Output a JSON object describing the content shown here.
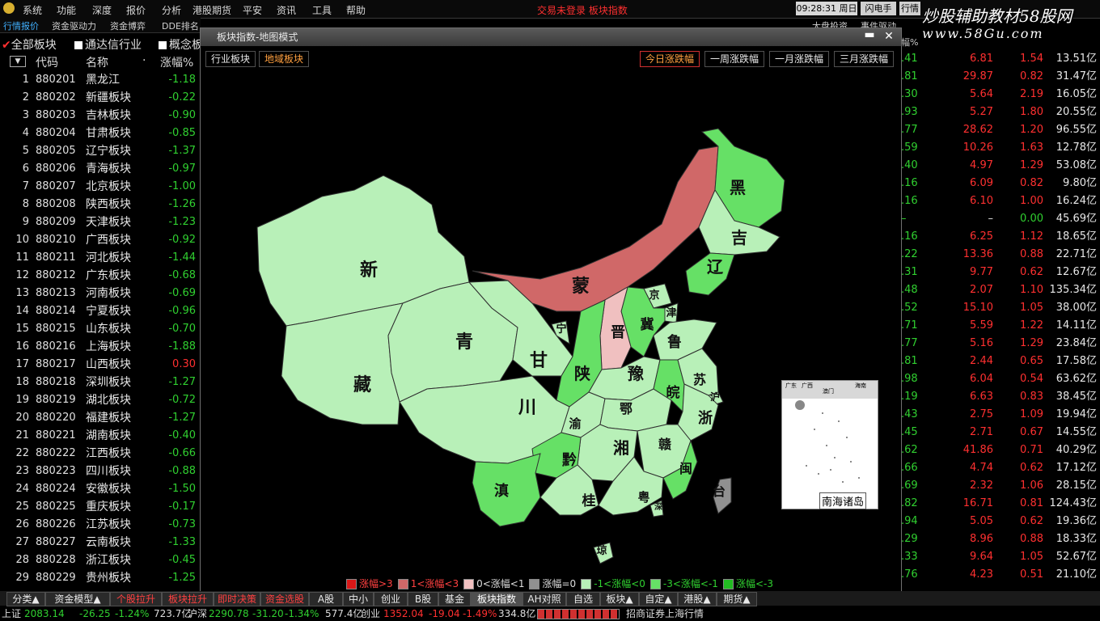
{
  "menu": [
    "系统",
    "功能",
    "深度",
    "报价",
    "分析",
    "港股期货",
    "平安",
    "资讯",
    "工具",
    "帮助"
  ],
  "menu_status": "交易未登录   板块指数",
  "clock": "09:28:31 周日",
  "top_buttons": [
    "闪电手",
    "行情"
  ],
  "watermark": {
    "line1": "炒股辅助教材58股网",
    "line2": "www.58Gu.com"
  },
  "tabs": [
    "行情报价",
    "资金驱动力",
    "资金博弈",
    "DDE排名"
  ],
  "right_top_tabs": [
    "大盘投资",
    "事件驱动"
  ],
  "filters": [
    "全部板块",
    "通达信行业",
    "概念板"
  ],
  "list_header": {
    "code": "代码",
    "name": "名称",
    "dot": "·",
    "pct": "涨幅%"
  },
  "rows": [
    {
      "no": "1",
      "code": "880201",
      "name": "黑龙江",
      "pct": "-1.18"
    },
    {
      "no": "2",
      "code": "880202",
      "name": "新疆板块",
      "pct": "-0.22"
    },
    {
      "no": "3",
      "code": "880203",
      "name": "吉林板块",
      "pct": "-0.90"
    },
    {
      "no": "4",
      "code": "880204",
      "name": "甘肃板块",
      "pct": "-0.85"
    },
    {
      "no": "5",
      "code": "880205",
      "name": "辽宁板块",
      "pct": "-1.37"
    },
    {
      "no": "6",
      "code": "880206",
      "name": "青海板块",
      "pct": "-0.97"
    },
    {
      "no": "7",
      "code": "880207",
      "name": "北京板块",
      "pct": "-1.00"
    },
    {
      "no": "8",
      "code": "880208",
      "name": "陕西板块",
      "pct": "-1.26"
    },
    {
      "no": "9",
      "code": "880209",
      "name": "天津板块",
      "pct": "-1.23"
    },
    {
      "no": "10",
      "code": "880210",
      "name": "广西板块",
      "pct": "-0.92"
    },
    {
      "no": "11",
      "code": "880211",
      "name": "河北板块",
      "pct": "-1.44"
    },
    {
      "no": "12",
      "code": "880212",
      "name": "广东板块",
      "pct": "-0.68"
    },
    {
      "no": "13",
      "code": "880213",
      "name": "河南板块",
      "pct": "-0.69"
    },
    {
      "no": "14",
      "code": "880214",
      "name": "宁夏板块",
      "pct": "-0.96"
    },
    {
      "no": "15",
      "code": "880215",
      "name": "山东板块",
      "pct": "-0.70"
    },
    {
      "no": "16",
      "code": "880216",
      "name": "上海板块",
      "pct": "-1.88"
    },
    {
      "no": "17",
      "code": "880217",
      "name": "山西板块",
      "pct": "0.30"
    },
    {
      "no": "18",
      "code": "880218",
      "name": "深圳板块",
      "pct": "-1.27"
    },
    {
      "no": "19",
      "code": "880219",
      "name": "湖北板块",
      "pct": "-0.72"
    },
    {
      "no": "20",
      "code": "880220",
      "name": "福建板块",
      "pct": "-1.27"
    },
    {
      "no": "21",
      "code": "880221",
      "name": "湖南板块",
      "pct": "-0.40"
    },
    {
      "no": "22",
      "code": "880222",
      "name": "江西板块",
      "pct": "-0.66"
    },
    {
      "no": "23",
      "code": "880223",
      "name": "四川板块",
      "pct": "-0.88"
    },
    {
      "no": "24",
      "code": "880224",
      "name": "安徽板块",
      "pct": "-1.50"
    },
    {
      "no": "25",
      "code": "880225",
      "name": "重庆板块",
      "pct": "-0.17"
    },
    {
      "no": "26",
      "code": "880226",
      "name": "江苏板块",
      "pct": "-0.73"
    },
    {
      "no": "27",
      "code": "880227",
      "name": "云南板块",
      "pct": "-1.33"
    },
    {
      "no": "28",
      "code": "880228",
      "name": "浙江板块",
      "pct": "-0.45"
    },
    {
      "no": "29",
      "code": "880229",
      "name": "贵州板块",
      "pct": "-1.25"
    }
  ],
  "right_header_frag": "幅%",
  "right_rows": [
    {
      "a": ".41",
      "b": "6.81",
      "c": "1.54",
      "d": "13.51亿"
    },
    {
      "a": ".81",
      "b": "29.87",
      "c": "0.82",
      "d": "31.47亿"
    },
    {
      "a": ".30",
      "b": "5.64",
      "c": "2.19",
      "d": "16.05亿"
    },
    {
      "a": ".93",
      "b": "5.27",
      "c": "1.80",
      "d": "20.55亿"
    },
    {
      "a": ".77",
      "b": "28.62",
      "c": "1.20",
      "d": "96.55亿"
    },
    {
      "a": ".59",
      "b": "10.26",
      "c": "1.63",
      "d": "12.78亿"
    },
    {
      "a": ".40",
      "b": "4.97",
      "c": "1.29",
      "d": "53.08亿"
    },
    {
      "a": ".16",
      "b": "6.09",
      "c": "0.82",
      "d": "9.80亿"
    },
    {
      "a": ".16",
      "b": "6.10",
      "c": "1.00",
      "d": "16.24亿"
    },
    {
      "a": "–",
      "b": "–",
      "c": "0.00",
      "d": "45.69亿"
    },
    {
      "a": ".16",
      "b": "6.25",
      "c": "1.12",
      "d": "18.65亿"
    },
    {
      "a": ".22",
      "b": "13.36",
      "c": "0.88",
      "d": "22.71亿"
    },
    {
      "a": ".31",
      "b": "9.77",
      "c": "0.62",
      "d": "12.67亿"
    },
    {
      "a": ".48",
      "b": "2.07",
      "c": "1.10",
      "d": "135.34亿"
    },
    {
      "a": ".52",
      "b": "15.10",
      "c": "1.05",
      "d": "38.00亿"
    },
    {
      "a": ".71",
      "b": "5.59",
      "c": "1.22",
      "d": "14.11亿"
    },
    {
      "a": ".77",
      "b": "5.16",
      "c": "1.29",
      "d": "23.84亿"
    },
    {
      "a": ".81",
      "b": "2.44",
      "c": "0.65",
      "d": "17.58亿"
    },
    {
      "a": ".98",
      "b": "6.04",
      "c": "0.54",
      "d": "63.62亿"
    },
    {
      "a": ".19",
      "b": "6.63",
      "c": "0.83",
      "d": "38.45亿"
    },
    {
      "a": ".43",
      "b": "2.75",
      "c": "1.09",
      "d": "19.94亿"
    },
    {
      "a": ".45",
      "b": "2.71",
      "c": "0.67",
      "d": "14.55亿"
    },
    {
      "a": ".62",
      "b": "41.86",
      "c": "0.71",
      "d": "40.29亿"
    },
    {
      "a": ".66",
      "b": "4.74",
      "c": "0.62",
      "d": "17.12亿"
    },
    {
      "a": ".69",
      "b": "2.32",
      "c": "1.06",
      "d": "28.15亿"
    },
    {
      "a": ".82",
      "b": "16.71",
      "c": "0.81",
      "d": "124.43亿"
    },
    {
      "a": ".94",
      "b": "5.05",
      "c": "0.62",
      "d": "19.36亿"
    },
    {
      "a": ".29",
      "b": "8.96",
      "c": "0.88",
      "d": "18.33亿"
    },
    {
      "a": ".33",
      "b": "9.64",
      "c": "1.05",
      "d": "52.67亿"
    },
    {
      "a": ".76",
      "b": "4.23",
      "c": "0.51",
      "d": "21.10亿"
    }
  ],
  "popup": {
    "title": "板块指数-地图模式",
    "left_tabs": [
      "行业板块",
      "地域板块"
    ],
    "right_tabs": [
      "今日涨跌幅",
      "一周涨跌幅",
      "一月涨跌幅",
      "三月涨跌幅"
    ],
    "provinces": [
      "新",
      "藏",
      "青",
      "甘",
      "宁",
      "蒙",
      "黑",
      "吉",
      "辽",
      "京",
      "津",
      "冀",
      "晋",
      "鲁",
      "陕",
      "豫",
      "川",
      "渝",
      "鄂",
      "皖",
      "苏",
      "沪",
      "浙",
      "湘",
      "赣",
      "黔",
      "滇",
      "桂",
      "粤",
      "闽",
      "台",
      "琼",
      "深"
    ],
    "inset_label": "南海诸岛",
    "inset_tiny": [
      "广东",
      "广西",
      "海南",
      "澳门"
    ],
    "legend": [
      "涨幅>3",
      "1<涨幅<3",
      "0<涨幅<1",
      "涨幅=0",
      "-1<涨幅<0",
      "-3<涨幅<-1",
      "涨幅<-3"
    ],
    "colors": {
      "c_up3": "#d81818",
      "c_up1": "#d06868",
      "c_up0": "#f0c0c0",
      "c_zero": "#909090",
      "c_dn0": "#b8f0b8",
      "c_dn1": "#66e066",
      "c_dn3": "#22bb22"
    }
  },
  "bottom_tabs": [
    "分类▲",
    "资金模型▲",
    "个股拉升",
    "板块拉升",
    "即时决策",
    "资金选股",
    "A股",
    "中小",
    "创业",
    "B股",
    "基金",
    "板块指数",
    "AH对照",
    "自选",
    "板块▲",
    "自定▲",
    "港股▲",
    "期货▲"
  ],
  "status": {
    "sh_label": "上证",
    "sh_val": "2083.14",
    "sh_chg": "-26.25",
    "sh_pct": "-1.24%",
    "sh_amt": "723.7亿",
    "hs_label": "沪深",
    "hs_val": "2290.78",
    "hs_chg": "-31.20",
    "hs_pct": "-1.34%",
    "hs_amt": "577.4亿",
    "cy_label": "创业",
    "cy_val": "1352.04",
    "cy_chg": "-19.04",
    "cy_pct": "-1.49%",
    "cy_amt": "334.8亿",
    "broker": "招商证券上海行情"
  }
}
